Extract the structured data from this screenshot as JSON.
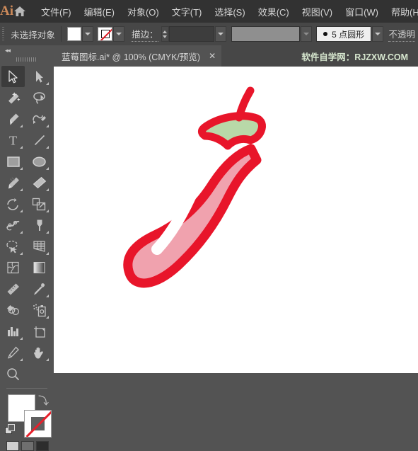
{
  "app": {
    "logo_text": "Ai",
    "home_icon": "home-icon"
  },
  "menu": {
    "items": [
      {
        "label": "文件(F)"
      },
      {
        "label": "编辑(E)"
      },
      {
        "label": "对象(O)"
      },
      {
        "label": "文字(T)"
      },
      {
        "label": "选择(S)"
      },
      {
        "label": "效果(C)"
      },
      {
        "label": "视图(V)"
      },
      {
        "label": "窗口(W)"
      },
      {
        "label": "帮助(H)"
      }
    ]
  },
  "control_bar": {
    "selection_status": "未选择对象",
    "fill_color": "#ffffff",
    "stroke_label": "描边：",
    "stroke_weight_value": "",
    "stroke_profile_value": "",
    "brush_label": "5 点圆形",
    "opacity_label": "不透明"
  },
  "tab": {
    "title": "蓝莓图标.ai* @ 100% (CMYK/预览)",
    "close_label": "✕",
    "watermark": "软件自学网：RJZXW.COM"
  },
  "toolbar": {
    "collapse_label": "◂◂",
    "tools": [
      {
        "name": "selection-tool",
        "active": true,
        "has_flyout": false
      },
      {
        "name": "direct-selection-tool",
        "active": false,
        "has_flyout": true
      },
      {
        "name": "magic-wand-tool",
        "active": false,
        "has_flyout": false
      },
      {
        "name": "lasso-tool",
        "active": false,
        "has_flyout": false
      },
      {
        "name": "pen-tool",
        "active": false,
        "has_flyout": true
      },
      {
        "name": "curvature-tool",
        "active": false,
        "has_flyout": true
      },
      {
        "name": "type-tool",
        "active": false,
        "has_flyout": true
      },
      {
        "name": "line-segment-tool",
        "active": false,
        "has_flyout": true
      },
      {
        "name": "rectangle-tool",
        "active": false,
        "has_flyout": true
      },
      {
        "name": "ellipse-tool",
        "active": false,
        "has_flyout": true
      },
      {
        "name": "paintbrush-tool",
        "active": false,
        "has_flyout": true
      },
      {
        "name": "shaper-tool",
        "active": false,
        "has_flyout": true
      },
      {
        "name": "rotate-tool",
        "active": false,
        "has_flyout": true
      },
      {
        "name": "scale-tool",
        "active": false,
        "has_flyout": true
      },
      {
        "name": "width-tool",
        "active": false,
        "has_flyout": true
      },
      {
        "name": "free-transform-tool",
        "active": false,
        "has_flyout": true
      },
      {
        "name": "shape-builder-tool",
        "active": false,
        "has_flyout": true
      },
      {
        "name": "perspective-grid-tool",
        "active": false,
        "has_flyout": true
      },
      {
        "name": "mesh-tool",
        "active": false,
        "has_flyout": false
      },
      {
        "name": "gradient-tool",
        "active": false,
        "has_flyout": false
      },
      {
        "name": "eyedropper-tool",
        "active": false,
        "has_flyout": true
      },
      {
        "name": "blend-tool",
        "active": false,
        "has_flyout": false
      },
      {
        "name": "symbol-sprayer-tool",
        "active": false,
        "has_flyout": true
      },
      {
        "name": "column-graph-tool",
        "active": false,
        "has_flyout": true
      },
      {
        "name": "artboard-tool",
        "active": false,
        "has_flyout": false
      },
      {
        "name": "slice-tool",
        "active": false,
        "has_flyout": true
      },
      {
        "name": "hand-tool",
        "active": false,
        "has_flyout": true
      },
      {
        "name": "zoom-tool",
        "active": false,
        "has_flyout": false
      }
    ],
    "fill_swatch_color": "#ffffff",
    "stroke_swatch_none": true,
    "swap_icon": "swap-fill-stroke-icon",
    "default_icon": "default-fill-stroke-icon",
    "color_modes": [
      "color-mode-white",
      "color-mode-gradient",
      "color-mode-none"
    ]
  },
  "artwork": {
    "name": "chili-pepper-illustration",
    "outline_color": "#e8152a",
    "body_color": "#f0a2ae",
    "leaf_color": "#b8d8a8",
    "highlight_color": "#ffffff"
  },
  "colors": {
    "menu_bg": "#323232",
    "control_bg": "#474747",
    "panel_bg": "#535353",
    "canvas_bg": "#ffffff",
    "accent": "#cd8a5a"
  }
}
